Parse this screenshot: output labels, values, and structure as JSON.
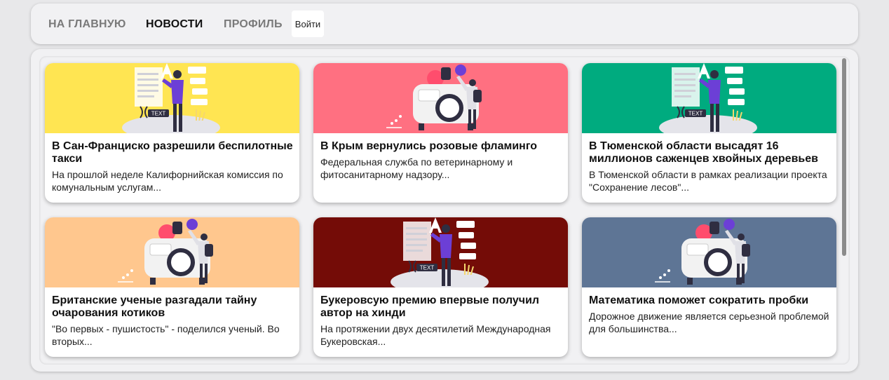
{
  "nav": {
    "home": "НА ГЛАВНУЮ",
    "news": "НОВОСТИ",
    "profile": "ПРОФИЛЬ",
    "login": "Войти"
  },
  "cards": [
    {
      "title": "В Сан-Франциско разрешили беспилотные такси",
      "text": "На прошлой неделе Калифорнийская комиссия по комунальным услугам...",
      "bg": "#ffe552",
      "illustration": "text-chat-illustration"
    },
    {
      "title": "В Крым вернулись розовые фламинго",
      "text": "Федеральная служба по ветеринарному и фитосанитарному надзору...",
      "bg": "#ff7081",
      "illustration": "van-travelers-illustration"
    },
    {
      "title": "В Тюменской области высадят 16 миллионов саженцев хвойных деревьев",
      "text": "В Тюменской области в рамках реализации проекта \"Сохранение лесов\"...",
      "bg": "#00ab7f",
      "illustration": "text-chat-illustration"
    },
    {
      "title": "Британские ученые разгадали тайну очарования котиков",
      "text": "\"Во первых - пушистость\" - поделился ученый. Во вторых...",
      "bg": "#ffc78e",
      "illustration": "van-travelers-illustration"
    },
    {
      "title": "Букеровсую премию впервые получил автор на хинди",
      "text": "На протяжении двух десятилетий Международная Букеровская...",
      "bg": "#740c07",
      "illustration": "text-chat-illustration"
    },
    {
      "title": "Математика поможет сократить пробки",
      "text": "Дорожное движение является серьезной проблемой для большинства...",
      "bg": "#5e7595",
      "illustration": "van-travelers-illustration"
    }
  ],
  "illustration_text": "TEXT"
}
